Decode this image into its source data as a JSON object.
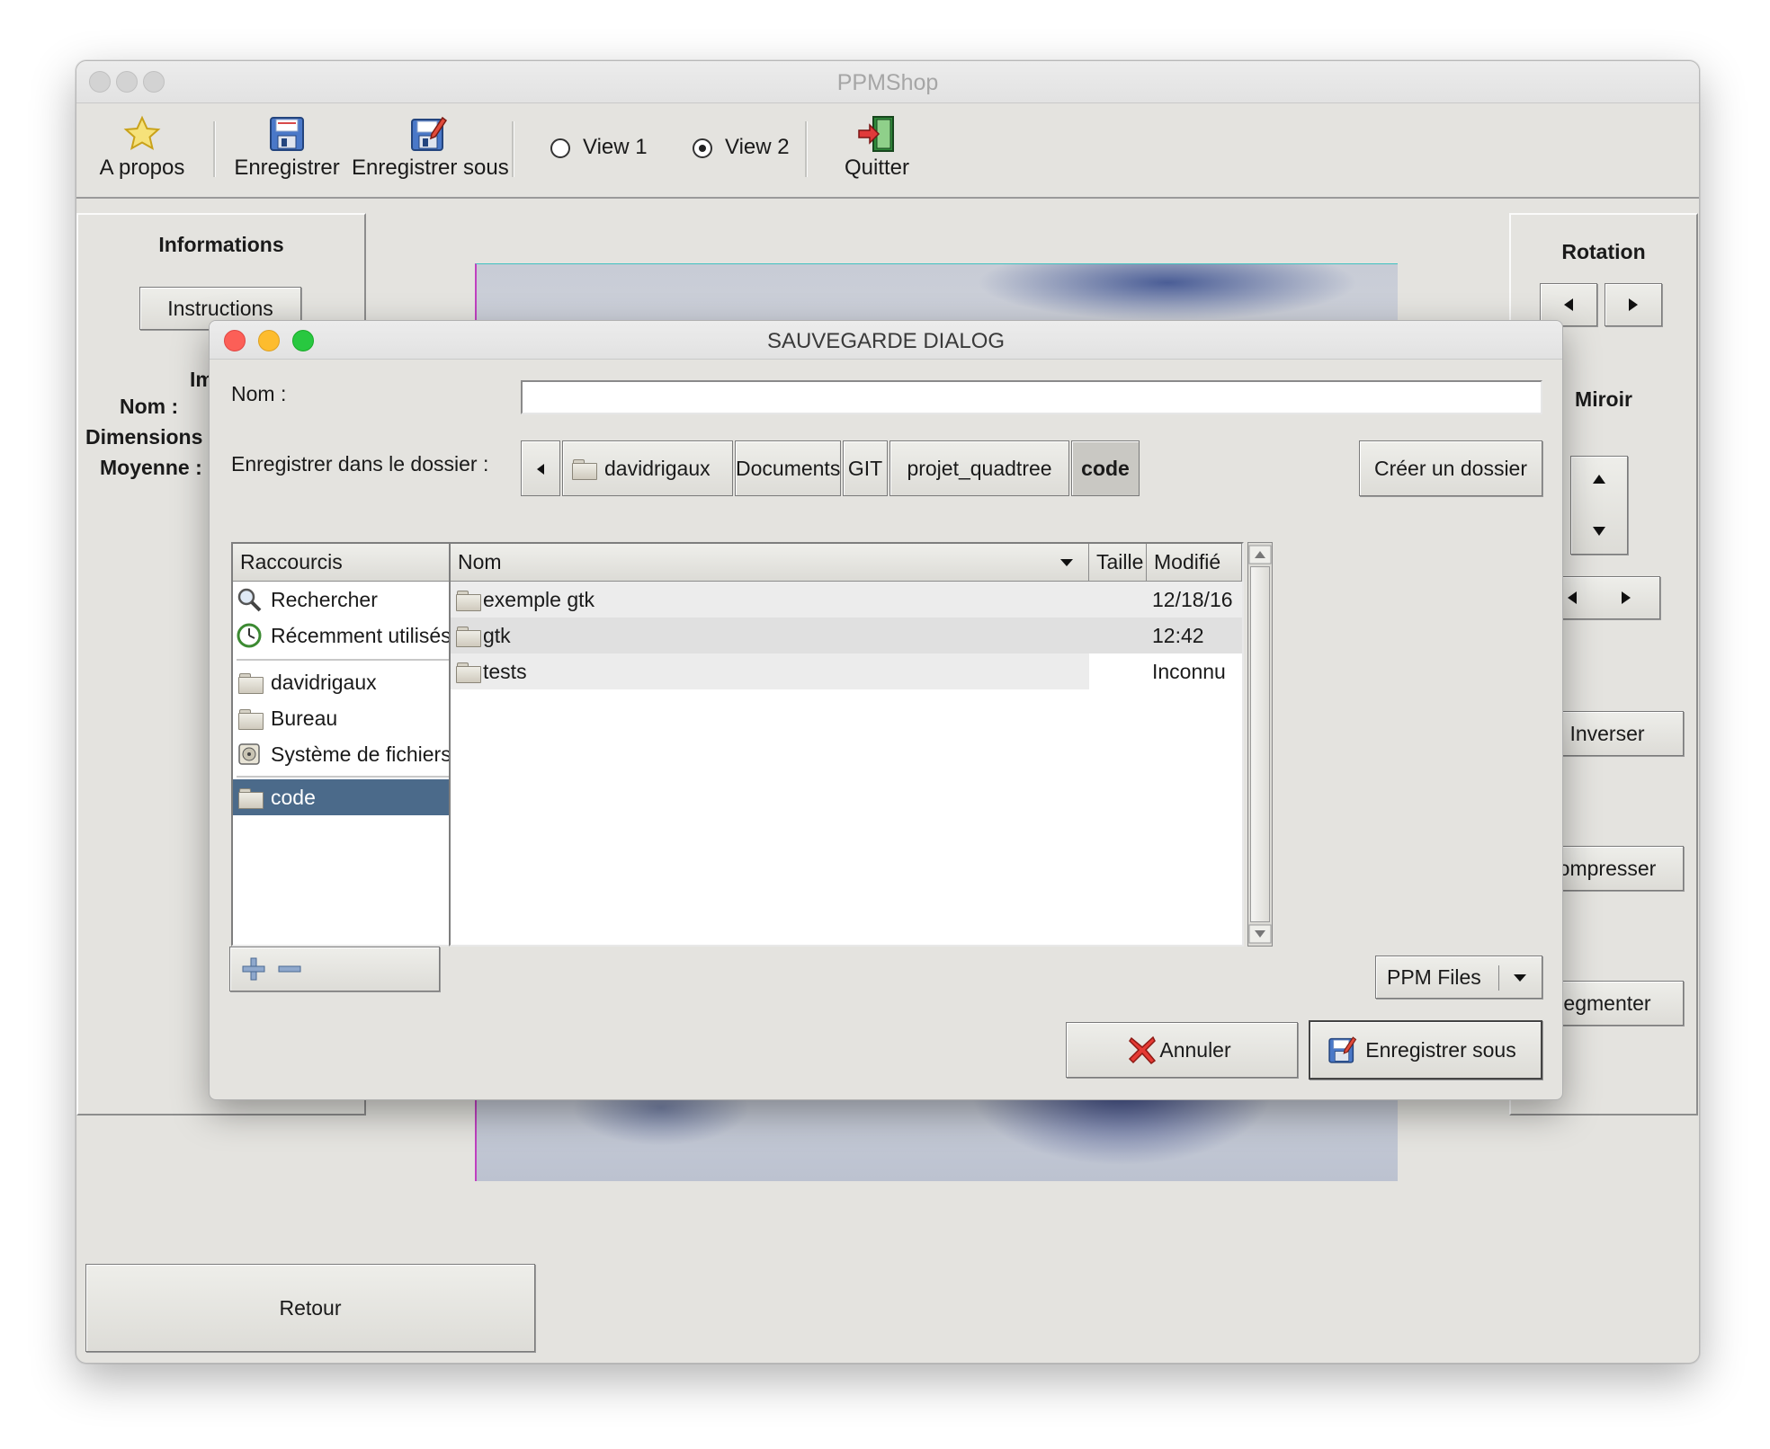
{
  "app": {
    "title": "PPMShop",
    "toolbar": {
      "about_label": "A propos",
      "save_label": "Enregistrer",
      "save_as_label": "Enregistrer sous",
      "view1_label": "View 1",
      "view2_label": "View 2",
      "view_selected": "View 2",
      "quit_label": "Quitter"
    },
    "left_panel": {
      "heading": "Informations",
      "instructions_button": "Instructions",
      "partial_label": "Im",
      "name_label": "Nom :",
      "dimensions_label": "Dimensions",
      "average_label": "Moyenne :"
    },
    "right_panel": {
      "rotation_heading": "Rotation",
      "mirror_heading": "Miroir",
      "invert_button": "Inverser",
      "compress_button": "ompresser",
      "segment_button": "egmenter"
    },
    "back_button": "Retour"
  },
  "dialog": {
    "title": "SAUVEGARDE DIALOG",
    "name_label": "Nom :",
    "name_value": "",
    "folder_label": "Enregistrer dans le dossier :",
    "path": [
      "davidrigaux",
      "Documents",
      "GIT",
      "projet_quadtree",
      "code"
    ],
    "active_path": "code",
    "create_folder_button": "Créer un dossier",
    "shortcuts": {
      "header": "Raccourcis",
      "search": "Rechercher",
      "recent": "Récemment utilisés",
      "places": [
        "davidrigaux",
        "Bureau",
        "Système de fichiers"
      ],
      "bookmarks": [
        "code"
      ],
      "selected": "code"
    },
    "files": {
      "columns": {
        "name": "Nom",
        "size": "Taille",
        "modified": "Modifié"
      },
      "rows": [
        {
          "name": "exemple gtk",
          "size": "",
          "modified": "12/18/16"
        },
        {
          "name": "gtk",
          "size": "",
          "modified": "12:42"
        },
        {
          "name": "tests",
          "size": "",
          "modified": "Inconnu"
        }
      ]
    },
    "filter_value": "PPM Files",
    "cancel_button": "Annuler",
    "save_as_button": "Enregistrer sous"
  },
  "colors": {
    "window_bg": "#e4e3df",
    "selection_bg": "#4b6a8a",
    "close_red": "#fc5f57",
    "minimize_yellow": "#fdbc2e",
    "zoom_green": "#28c840"
  }
}
